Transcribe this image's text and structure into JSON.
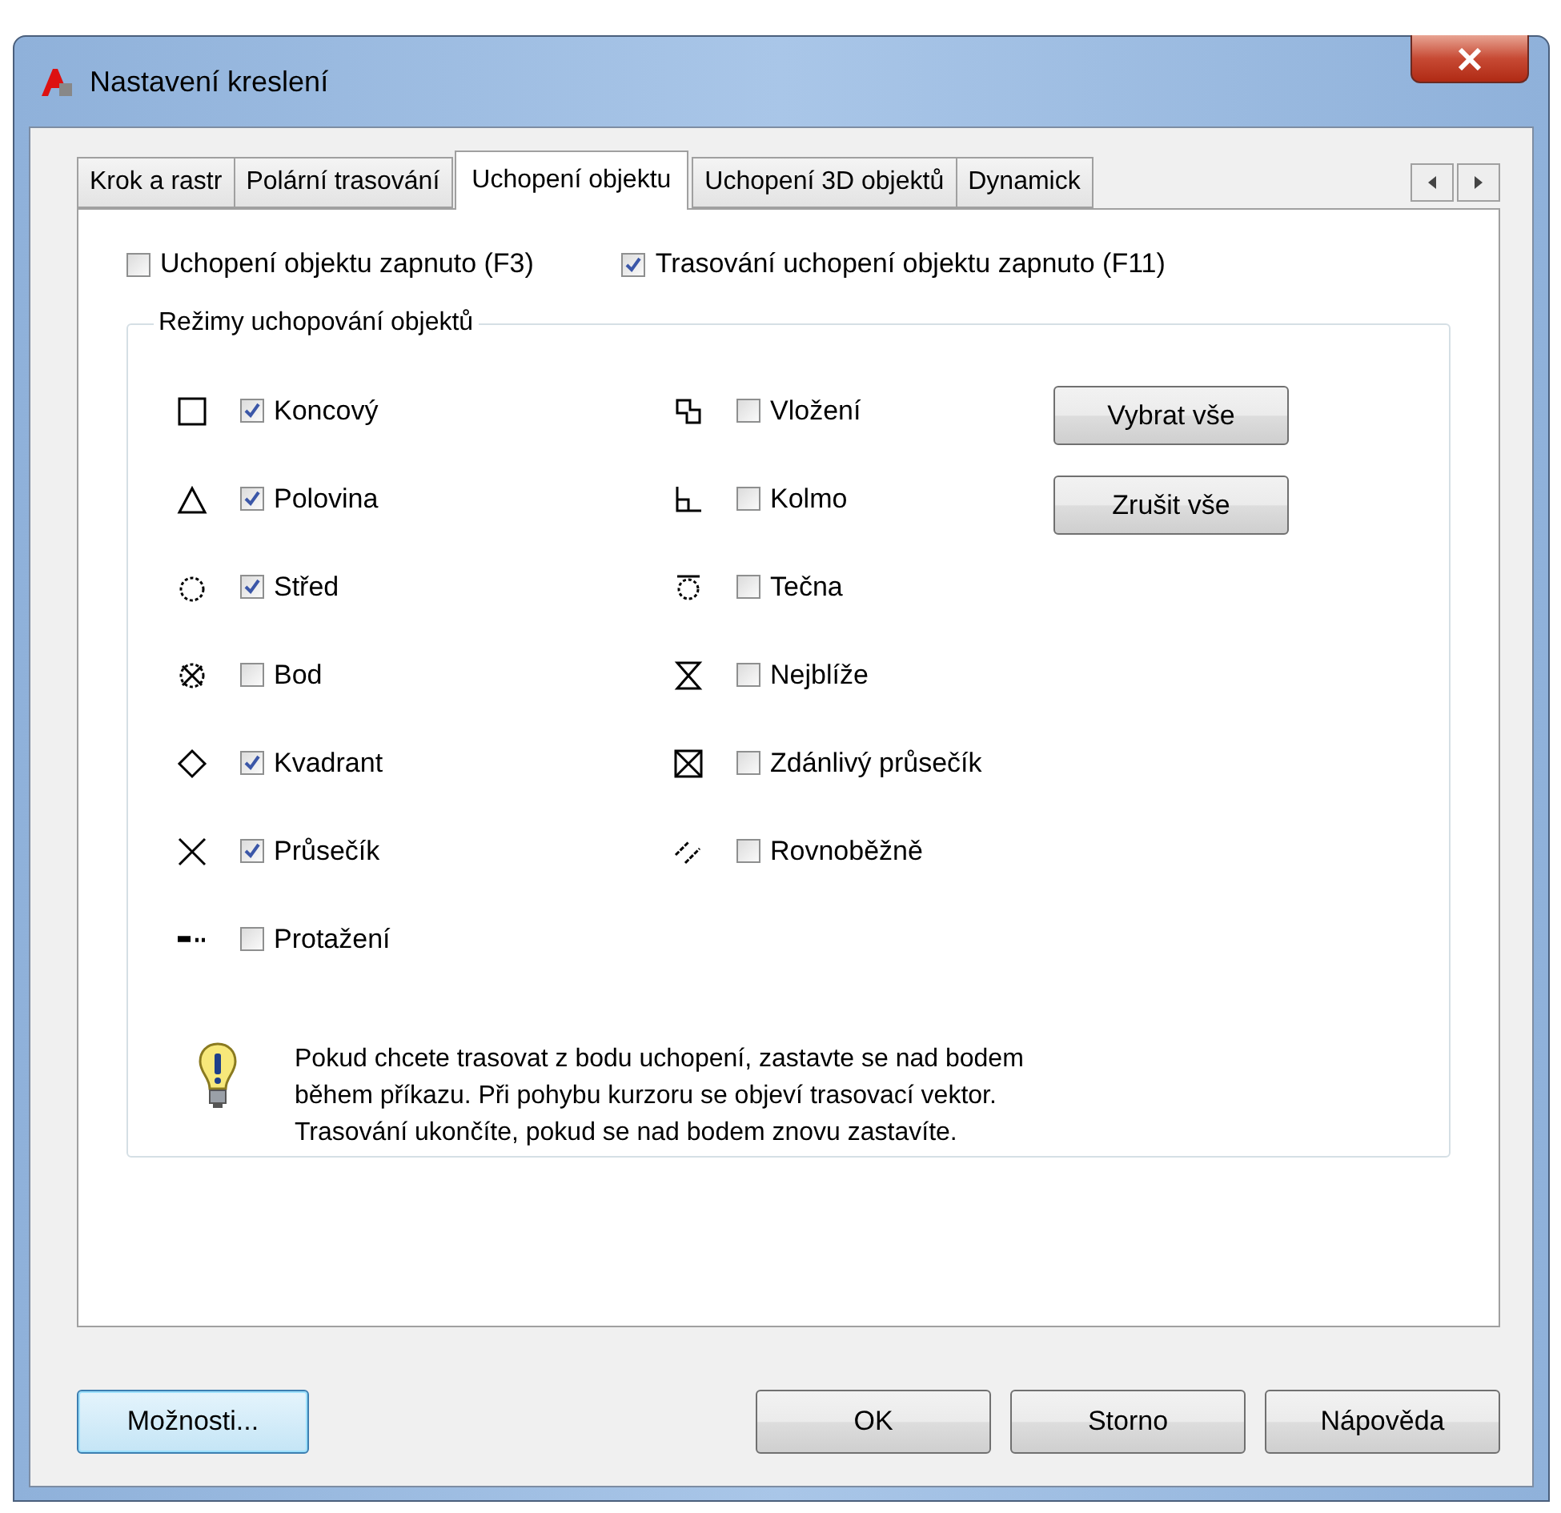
{
  "window": {
    "title": "Nastavení kreslení"
  },
  "tabs": [
    {
      "label": "Krok a rastr",
      "selected": false
    },
    {
      "label": "Polární trasování",
      "selected": false
    },
    {
      "label": "Uchopení objektu",
      "selected": true
    },
    {
      "label": "Uchopení 3D objektů",
      "selected": false
    },
    {
      "label": "Dynamick",
      "selected": false
    }
  ],
  "toggles": [
    {
      "label": "Uchopení objektu zapnuto (F3)",
      "checked": false
    },
    {
      "label": "Trasování uchopení objektu zapnuto (F11)",
      "checked": true
    }
  ],
  "group": {
    "title": "Režimy uchopování objektů",
    "left": [
      {
        "kind": "square",
        "label": "Koncový",
        "checked": true
      },
      {
        "kind": "triangle",
        "label": "Polovina",
        "checked": true
      },
      {
        "kind": "circle",
        "label": "Střed",
        "checked": true
      },
      {
        "kind": "node",
        "label": "Bod",
        "checked": false
      },
      {
        "kind": "diamond",
        "label": "Kvadrant",
        "checked": true
      },
      {
        "kind": "cross",
        "label": "Průsečík",
        "checked": true
      },
      {
        "kind": "extension",
        "label": "Protažení",
        "checked": false
      }
    ],
    "right": [
      {
        "kind": "insertion",
        "label": "Vložení",
        "checked": false
      },
      {
        "kind": "perpendicular",
        "label": "Kolmo",
        "checked": false
      },
      {
        "kind": "tangent",
        "label": "Tečna",
        "checked": false
      },
      {
        "kind": "nearest",
        "label": "Nejblíže",
        "checked": false
      },
      {
        "kind": "apparent",
        "label": "Zdánlivý průsečík",
        "checked": false
      },
      {
        "kind": "parallel",
        "label": "Rovnoběžně",
        "checked": false
      }
    ],
    "buttons": [
      "Vybrat vše",
      "Zrušit vše"
    ],
    "hint": [
      "Pokud chcete trasovat z bodu uchopení, zastavte se nad bodem",
      "během příkazu. Při pohybu kurzoru se objeví trasovací vektor.",
      "Trasování ukončíte, pokud se nad bodem znovu zastavíte."
    ]
  },
  "footer": {
    "options": "Možnosti...",
    "buttons": [
      "OK",
      "Storno",
      "Nápověda"
    ]
  }
}
